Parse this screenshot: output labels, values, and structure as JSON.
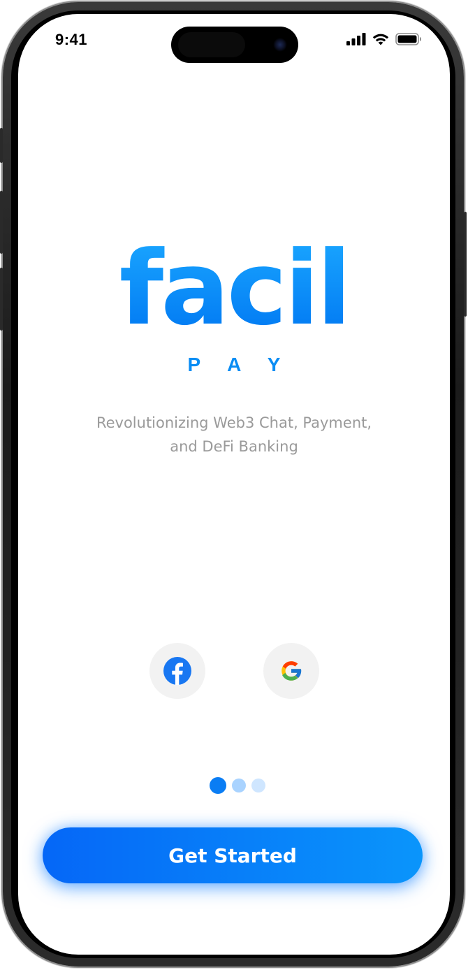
{
  "status_bar": {
    "time": "9:41"
  },
  "logo": {
    "word": "facil",
    "sub": "PAY"
  },
  "tagline": "Revolutionizing Web3 Chat, Payment, and DeFi Banking",
  "social": [
    {
      "name": "facebook",
      "icon": "facebook-icon",
      "color": "#1877F2"
    },
    {
      "name": "google",
      "icon": "google-icon"
    }
  ],
  "pager": {
    "count": 3,
    "active_index": 0
  },
  "cta": {
    "label": "Get Started"
  },
  "colors": {
    "brand": "#0A8DF4",
    "cta_start": "#0567F7",
    "cta_end": "#0A95FB",
    "tagline": "#9A9A9A"
  }
}
